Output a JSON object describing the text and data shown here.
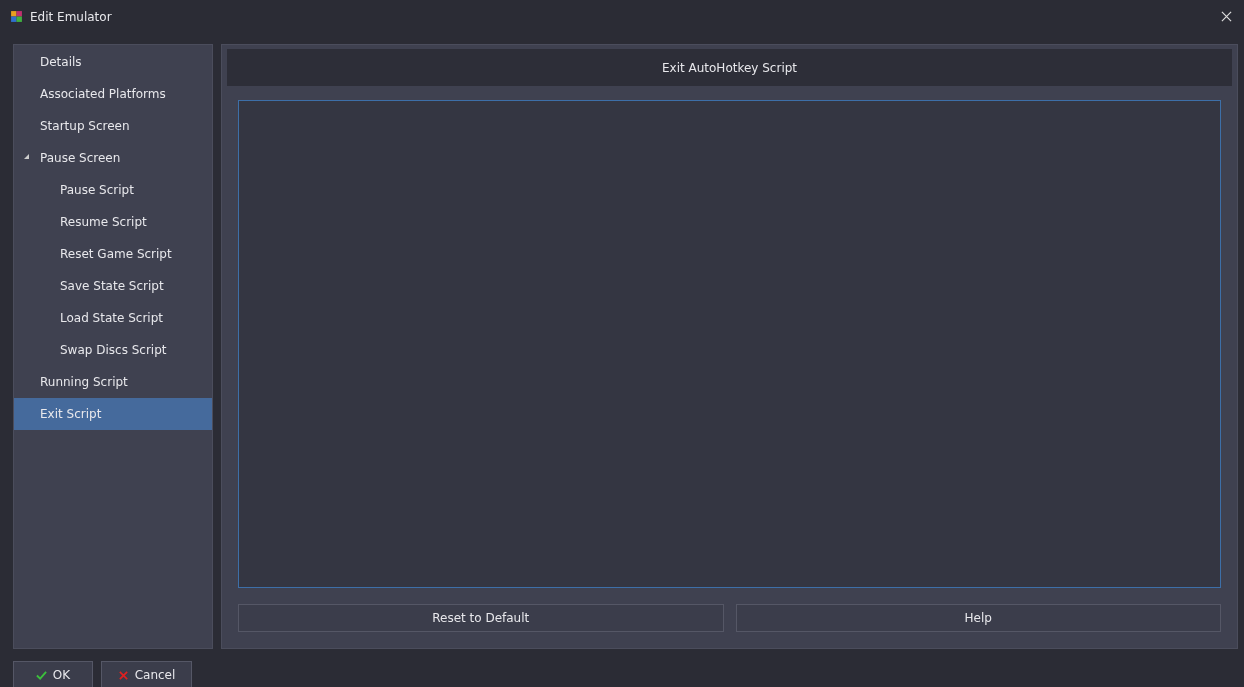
{
  "window": {
    "title": "Edit Emulator"
  },
  "sidebar": {
    "items": [
      {
        "label": "Details",
        "selected": false
      },
      {
        "label": "Associated Platforms",
        "selected": false
      },
      {
        "label": "Startup Screen",
        "selected": false
      },
      {
        "label": "Pause Screen",
        "selected": false,
        "expanded": true,
        "children": [
          {
            "label": "Pause Script",
            "selected": false
          },
          {
            "label": "Resume Script",
            "selected": false
          },
          {
            "label": "Reset Game Script",
            "selected": false
          },
          {
            "label": "Save State Script",
            "selected": false
          },
          {
            "label": "Load State Script",
            "selected": false
          },
          {
            "label": "Swap Discs Script",
            "selected": false
          }
        ]
      },
      {
        "label": "Running Script",
        "selected": false
      },
      {
        "label": "Exit Script",
        "selected": true
      }
    ]
  },
  "panel": {
    "header": "Exit AutoHotkey Script",
    "buttons": [
      "Reset to Default",
      "Help"
    ]
  },
  "footer": {
    "buttons": [
      {
        "label": "OK",
        "kind": "ok"
      },
      {
        "label": "Cancel",
        "kind": "cancel"
      }
    ]
  }
}
